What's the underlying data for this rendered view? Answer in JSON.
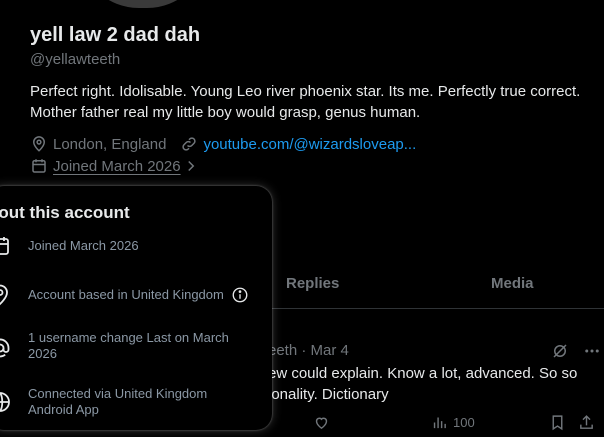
{
  "profile": {
    "display_name": "yell law 2 dad dah",
    "handle": "@yellawteeth",
    "bio_line1": "Perfect right. Idolisable. Young Leo river phoenix star. Its me. Perfectly true correct.",
    "bio_line2": "Mother father real my little boy would grasp, genus human.",
    "location": "London, England",
    "website": "youtube.com/@wizardsloveap...",
    "joined": "Joined March 2026"
  },
  "tabs": [
    {
      "label": "Replies"
    },
    {
      "label": "Media"
    }
  ],
  "post": {
    "header": "eeth · Mar 4",
    "line1": "ew could explain. Know a lot, advanced. So so",
    "line2": "ionality. Dictionary",
    "views": "100"
  },
  "about_popover": {
    "title": "bout this account",
    "items": [
      {
        "icon": "calendar-icon",
        "text": "Joined March 2026"
      },
      {
        "icon": "location-pin-icon",
        "text": "Account based in United Kingdom"
      },
      {
        "icon": "at-sign-icon",
        "text": "1 username change Last on March 2026"
      },
      {
        "icon": "globe-icon",
        "text": "Connected via United Kingdom Android App"
      }
    ]
  },
  "colors": {
    "background": "#000000",
    "text_primary": "#e7e9ea",
    "text_secondary": "#71767b",
    "link": "#1d9bf0",
    "divider": "#2f3336"
  }
}
